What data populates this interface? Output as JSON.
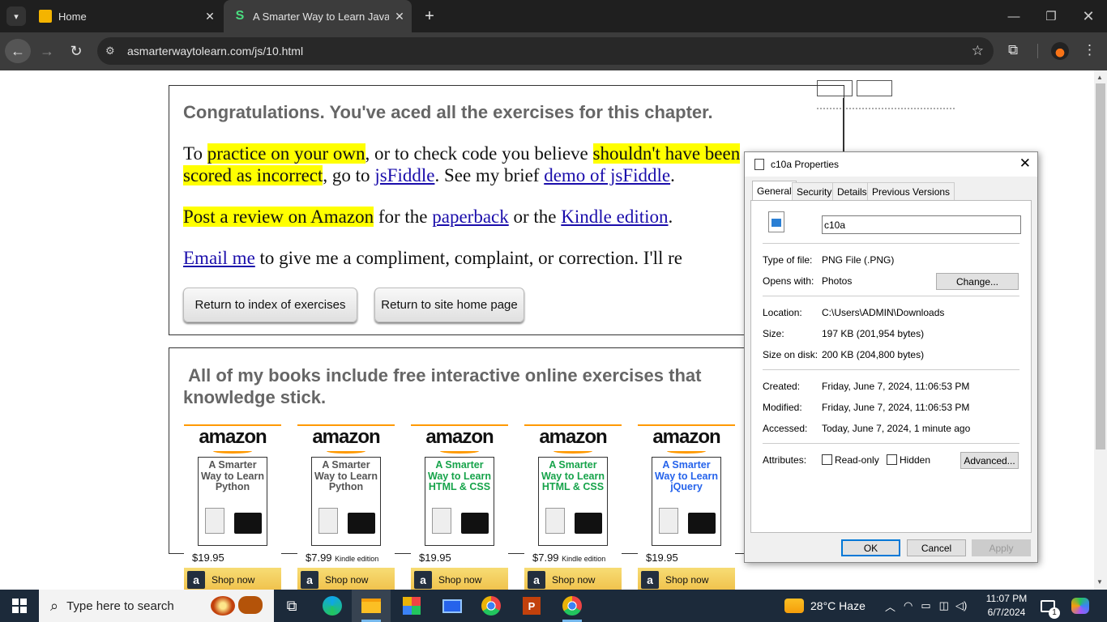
{
  "browser": {
    "tabs": [
      {
        "title": "Home"
      },
      {
        "title": "A Smarter Way to Learn JavaSc"
      }
    ],
    "url": "asmarterwaytolearn.com/js/10.html"
  },
  "page": {
    "heading": "Congratulations. You've aced all the exercises for this chapter.",
    "p1": {
      "t1": "To ",
      "h1": "practice on your own",
      "t2": ", or to check code you believe ",
      "h2": "shouldn't have been",
      "h3": "scored as incorrect",
      "t3": ", go to ",
      "link1": "jsFiddle",
      "t4": ". See my brief ",
      "link2": "demo of jsFiddle",
      "t5": "."
    },
    "p2": {
      "h1": "Post a review on Amazon",
      "t1": " for the ",
      "link1": "paperback",
      "t2": " or the ",
      "link2": "Kindle edition",
      "t3": "."
    },
    "p3": {
      "link1": "Email me",
      "t1": " to give me a compliment, complaint, or correction. I'll re"
    },
    "buttons": {
      "index": "Return to index of exercises",
      "home": "Return to site home page"
    },
    "books_heading_1": "All of my books include free interactive online exercises that",
    "books_heading_2": "knowledge stick.",
    "books": [
      {
        "cover": "A Smarter Way to Learn Python",
        "price": "$19.95",
        "edition": "",
        "color": "#555555"
      },
      {
        "cover": "A Smarter Way to Learn Python",
        "price": "$7.99",
        "edition": "Kindle edition",
        "color": "#555555"
      },
      {
        "cover": "A Smarter Way to Learn HTML & CSS",
        "price": "$19.95",
        "edition": "",
        "color": "#16a34a"
      },
      {
        "cover": "A Smarter Way to Learn HTML & CSS",
        "price": "$7.99",
        "edition": "Kindle edition",
        "color": "#16a34a"
      },
      {
        "cover": "A Smarter Way to Learn jQuery",
        "price": "$19.95",
        "edition": "",
        "color": "#2563eb"
      }
    ],
    "amazon": "amazon",
    "shop_now": "Shop now"
  },
  "dialog": {
    "title": "c10a Properties",
    "tabs": [
      "General",
      "Security",
      "Details",
      "Previous Versions"
    ],
    "filename": "c10a",
    "type_label": "Type of file:",
    "type_value": "PNG File (.PNG)",
    "opens_label": "Opens with:",
    "opens_value": "Photos",
    "change": "Change...",
    "location_label": "Location:",
    "location_value": "C:\\Users\\ADMIN\\Downloads",
    "size_label": "Size:",
    "size_value": "197 KB (201,954 bytes)",
    "disk_label": "Size on disk:",
    "disk_value": "200 KB (204,800 bytes)",
    "created_label": "Created:",
    "created_value": "Friday, June 7, 2024, 11:06:53 PM",
    "modified_label": "Modified:",
    "modified_value": "Friday, June 7, 2024, 11:06:53 PM",
    "accessed_label": "Accessed:",
    "accessed_value": "Today, June 7, 2024, 1 minute ago",
    "attributes_label": "Attributes:",
    "readonly": "Read-only",
    "hidden": "Hidden",
    "advanced": "Advanced...",
    "ok": "OK",
    "cancel": "Cancel",
    "apply": "Apply"
  },
  "taskbar": {
    "search_placeholder": "Type here to search",
    "weather": "28°C  Haze",
    "time": "11:07 PM",
    "date": "6/7/2024",
    "notifications": "1"
  }
}
